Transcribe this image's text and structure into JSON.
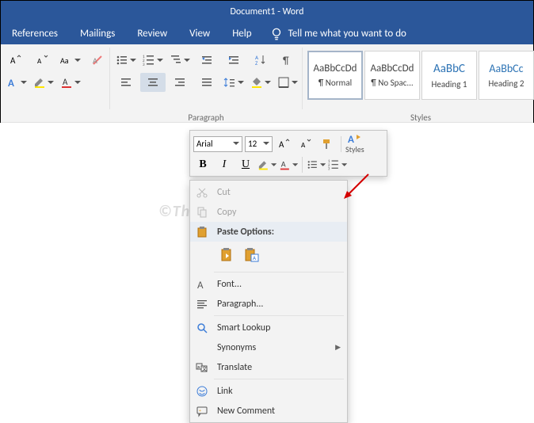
{
  "title": {
    "doc": "Document1",
    "sep": " - ",
    "app": "Word"
  },
  "tabs": [
    "References",
    "Mailings",
    "Review",
    "View",
    "Help"
  ],
  "tellme": "Tell me what you want to do",
  "ribbon_labels": {
    "paragraph": "Paragraph",
    "styles": "Styles"
  },
  "styles_gallery": [
    {
      "preview": "AaBbCcDd",
      "name": "¶ Normal",
      "cls": ""
    },
    {
      "preview": "AaBbCcDd",
      "name": "¶ No Spac...",
      "cls": ""
    },
    {
      "preview": "AaBbC",
      "name": "Heading 1",
      "cls": "h1"
    },
    {
      "preview": "AaBbCc",
      "name": "Heading 2",
      "cls": "h2"
    }
  ],
  "mini": {
    "font": "Arial",
    "size": "12",
    "bold": "B",
    "italic": "I",
    "underline": "U",
    "styles_label": "Styles"
  },
  "context_menu": {
    "cut": "Cut",
    "copy": "Copy",
    "paste_header": "Paste Options:",
    "font": "Font...",
    "paragraph": "Paragraph...",
    "smart_lookup": "Smart Lookup",
    "synonyms": "Synonyms",
    "translate": "Translate",
    "link": "Link",
    "new_comment": "New Comment"
  },
  "watermark": "©TheGeekPage.com"
}
